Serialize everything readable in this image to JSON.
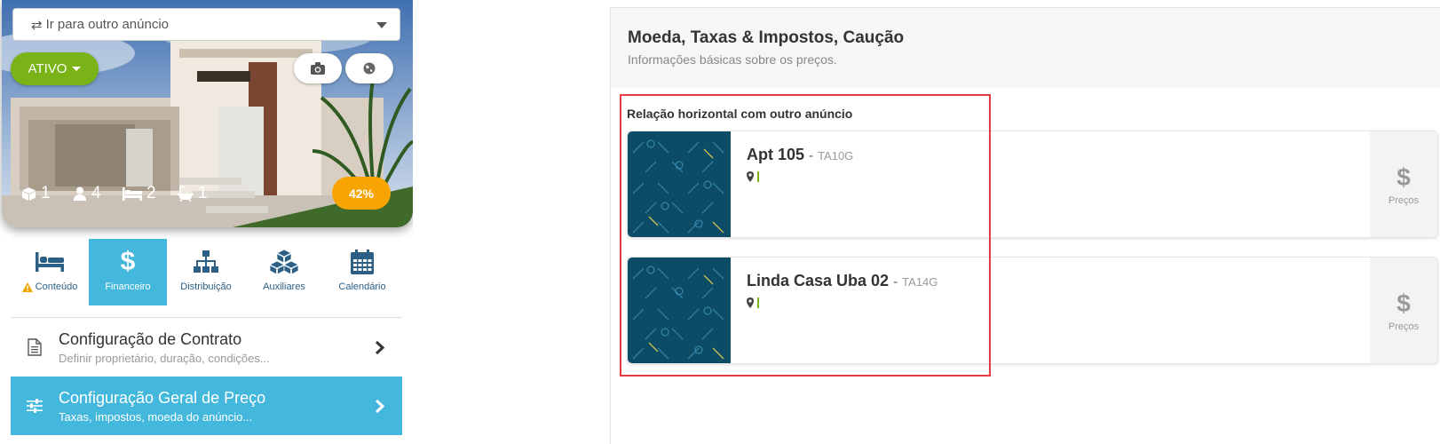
{
  "listing_switcher": {
    "label": "Ir para outro anúncio",
    "icon": "swap-icon"
  },
  "status": {
    "label": "ATIVO",
    "color": "#7ab317"
  },
  "hero_actions": [
    {
      "name": "camera-button",
      "icon": "camera-icon"
    },
    {
      "name": "globe-button",
      "icon": "globe-icon"
    }
  ],
  "features": [
    {
      "icon": "box-icon",
      "value": "1"
    },
    {
      "icon": "user-icon",
      "value": "4"
    },
    {
      "icon": "bed-icon",
      "value": "2"
    },
    {
      "icon": "bathtub-icon",
      "value": "1"
    }
  ],
  "completion": {
    "label": "42%",
    "value": 0.42
  },
  "tabs": [
    {
      "label": "Conteúdo",
      "icon": "bed-icon",
      "warning": true
    },
    {
      "label": "Financeiro",
      "icon": "dollar-icon",
      "active": true
    },
    {
      "label": "Distribuição",
      "icon": "sitemap-icon"
    },
    {
      "label": "Auxiliares",
      "icon": "cubes-icon"
    },
    {
      "label": "Calendário",
      "icon": "calendar-icon"
    }
  ],
  "menu": [
    {
      "title": "Configuração de Contrato",
      "subtitle": "Definir proprietário, duração, condições...",
      "icon": "document-icon"
    },
    {
      "title": "Configuração Geral de Preço",
      "subtitle": "Taxas, impostos, moeda do anúncio...",
      "icon": "sliders-icon",
      "active": true
    }
  ],
  "panel": {
    "title": "Moeda, Taxas & Impostos, Caução",
    "subtitle": "Informações básicas sobre os preços."
  },
  "relation": {
    "title": "Relação horizontal com outro anúncio",
    "cards": [
      {
        "name": "Apt 105",
        "separator": "-",
        "code": "TA10G",
        "price_label": "Preços",
        "price_icon": "$"
      },
      {
        "name": "Linda Casa Uba 02",
        "separator": "-",
        "code": "TA14G",
        "price_label": "Preços",
        "price_icon": "$"
      }
    ]
  },
  "colors": {
    "accent": "#43b7dc",
    "highlight": "#e53b45",
    "badge": "#f7a400",
    "thumb": "#0d4c66"
  }
}
